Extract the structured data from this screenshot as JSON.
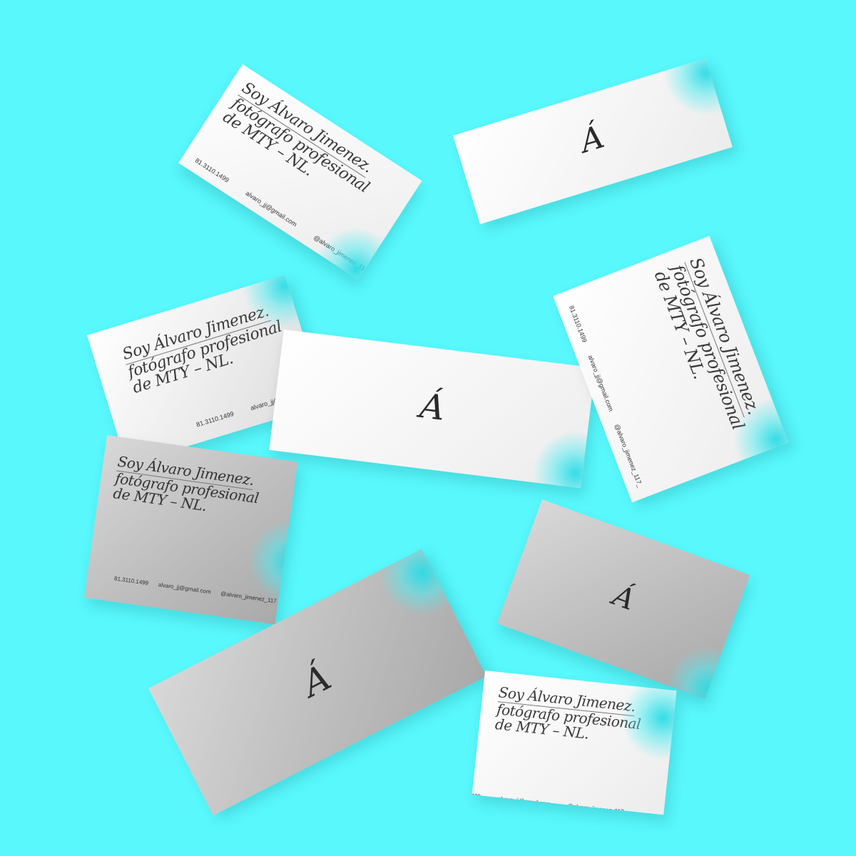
{
  "monogram": "Á",
  "headline": {
    "line1": "Soy Álvaro Jimenez.",
    "line2": "fotógrafo profesional",
    "line3": "de MTY – NL."
  },
  "contact": {
    "phone": "81.3110.1499",
    "email": "alvaro_jj@gmail.com",
    "instagram": "@alvaro_jimenez_117_",
    "instagram_short": "@alvaro_jimenez_117"
  },
  "colors": {
    "background": "#58f8fc",
    "accent_glow": "#2bdce6",
    "card_white": "#f7f7f7",
    "card_gray": "#bdbdbd"
  }
}
